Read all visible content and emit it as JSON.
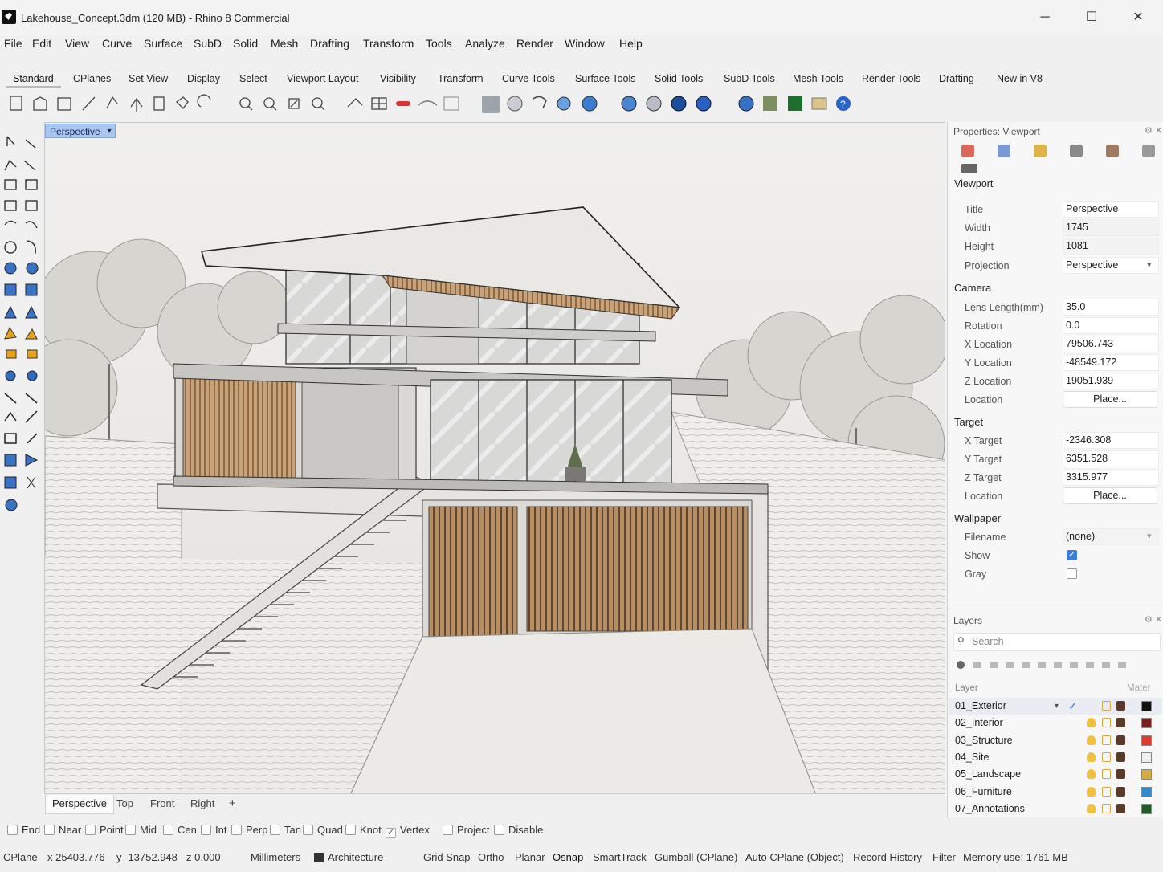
{
  "window": {
    "title": "Lakehouse_Concept.3dm (120 MB) - Rhino 8 Commercial",
    "minimize": "─",
    "maximize": "☐",
    "close": "✕"
  },
  "menu": [
    "File",
    "Edit",
    "View",
    "Curve",
    "Surface",
    "SubD",
    "Solid",
    "Mesh",
    "Drafting",
    "Transform",
    "Tools",
    "Analyze",
    "Render",
    "Window",
    "Help"
  ],
  "toolbar_tabs": [
    "Standard",
    "CPlanes",
    "Set View",
    "Display",
    "Select",
    "Viewport Layout",
    "Visibility",
    "Transform",
    "Curve Tools",
    "Surface Tools",
    "Solid Tools",
    "SubD Tools",
    "Mesh Tools",
    "Render Tools",
    "Drafting",
    "New in V8"
  ],
  "viewport": {
    "label": "Perspective",
    "tabs": [
      "Perspective",
      "Top",
      "Front",
      "Right"
    ],
    "add_tab": "+"
  },
  "osnaps": [
    {
      "label": "End",
      "checked": false
    },
    {
      "label": "Near",
      "checked": false
    },
    {
      "label": "Point",
      "checked": false
    },
    {
      "label": "Mid",
      "checked": false
    },
    {
      "label": "Cen",
      "checked": false
    },
    {
      "label": "Int",
      "checked": false
    },
    {
      "label": "Perp",
      "checked": false
    },
    {
      "label": "Tan",
      "checked": false
    },
    {
      "label": "Quad",
      "checked": false
    },
    {
      "label": "Knot",
      "checked": false
    },
    {
      "label": "Vertex",
      "checked": true
    },
    {
      "label": "Project",
      "checked": false
    },
    {
      "label": "Disable",
      "checked": false
    }
  ],
  "status": {
    "cplane": "CPlane",
    "x": "x 25403.776",
    "y": "y -13752.948",
    "z": "z 0.000",
    "units": "Millimeters",
    "layer": "Architecture",
    "layer_color": "#333333",
    "grid_snap": "Grid Snap",
    "ortho": "Ortho",
    "planar": "Planar",
    "osnap": "Osnap",
    "smarttrack": "SmartTrack",
    "gumball": "Gumball (CPlane)",
    "autocplane": "Auto CPlane (Object)",
    "record_history": "Record History",
    "filter": "Filter",
    "memory": "Memory use: 1761 MB"
  },
  "properties": {
    "panel_title": "Properties: Viewport",
    "section_name": "Viewport",
    "title_label": "Title",
    "title_value": "Perspective",
    "width_label": "Width",
    "width_value": "1745",
    "height_label": "Height",
    "height_value": "1081",
    "projection_label": "Projection",
    "projection_value": "Perspective",
    "camera_header": "Camera",
    "lens_label": "Lens Length(mm)",
    "lens_value": "35.0",
    "rotation_label": "Rotation",
    "rotation_value": "0.0",
    "xloc_label": "X Location",
    "xloc_value": "79506.743",
    "yloc_label": "Y Location",
    "yloc_value": "-48549.172",
    "zloc_label": "Z Location",
    "zloc_value": "19051.939",
    "location_label": "Location",
    "place_label": "Place...",
    "target_header": "Target",
    "xt_label": "X Target",
    "xt_value": "-2346.308",
    "yt_label": "Y Target",
    "yt_value": "6351.528",
    "zt_label": "Z Target",
    "zt_value": "3315.977",
    "tloc_label": "Location",
    "tplace_label": "Place...",
    "wallpaper_header": "Wallpaper",
    "filename_label": "Filename",
    "filename_value": "(none)",
    "show_label": "Show",
    "show_checked": true,
    "gray_label": "Gray",
    "gray_checked": false
  },
  "layers": {
    "panel_title": "Layers",
    "search_placeholder": "Search",
    "col_layer": "Layer",
    "col_material": "Mater",
    "rows": [
      {
        "name": "01_Exterior",
        "color": "#111111",
        "current": true
      },
      {
        "name": "02_Interior",
        "color": "#7a1e1e",
        "current": false
      },
      {
        "name": "03_Structure",
        "color": "#e03a2a",
        "current": false
      },
      {
        "name": "04_Site",
        "color": "#f2f0ee",
        "current": false
      },
      {
        "name": "05_Landscape",
        "color": "#d9a93a",
        "current": false
      },
      {
        "name": "06_Furniture",
        "color": "#2f8ad0",
        "current": false
      },
      {
        "name": "07_Annotations",
        "color": "#1f5c2a",
        "current": false
      }
    ]
  }
}
